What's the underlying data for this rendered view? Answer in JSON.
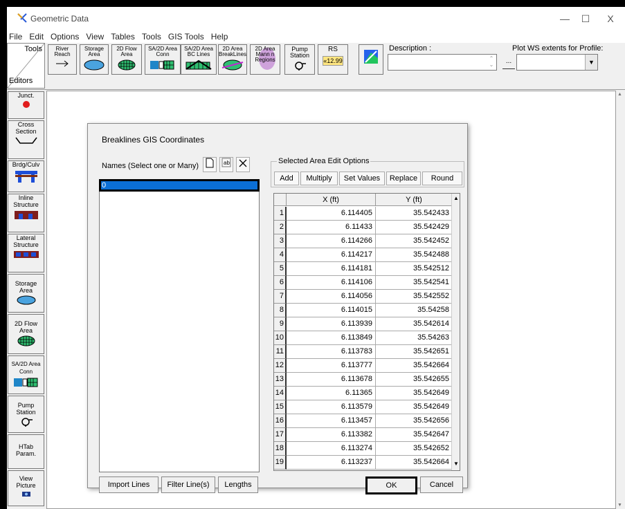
{
  "window": {
    "title": "Geometric Data",
    "controls": {
      "minimize": "—",
      "maximize": "☐",
      "close": "X"
    }
  },
  "menu": [
    "File",
    "Edit",
    "Options",
    "View",
    "Tables",
    "Tools",
    "GIS Tools",
    "Help"
  ],
  "toolbar": {
    "tools_label": "Tools",
    "editors_label": "Editors",
    "buttons": [
      {
        "line1": "River",
        "line2": "Reach"
      },
      {
        "line1": "Storage",
        "line2": "Area"
      },
      {
        "line1": "2D Flow",
        "line2": "Area"
      },
      {
        "line1": "SA/2D Area",
        "line2": "Conn"
      },
      {
        "line1": "SA/2D Area",
        "line2": "BC Lines"
      },
      {
        "line1": "2D Area",
        "line2": "BreakLines"
      },
      {
        "line1": "2D Area",
        "line2": "Mann n",
        "line3": "Regions"
      },
      {
        "line1": "Pump",
        "line2": "Station"
      },
      {
        "line1": "RS",
        "line2": "12.99"
      }
    ],
    "description_label": "Description :",
    "ellipsis": "...",
    "plot_ws_label": "Plot WS extents for Profile:"
  },
  "sidebar": [
    {
      "line1": "Junct.",
      "line2": ""
    },
    {
      "line1": "Cross",
      "line2": "Section"
    },
    {
      "line1": "Brdg/Culv",
      "line2": ""
    },
    {
      "line1": "Inline",
      "line2": "Structure"
    },
    {
      "line1": "Lateral",
      "line2": "Structure"
    },
    {
      "line1": "Storage",
      "line2": "Area"
    },
    {
      "line1": "2D Flow",
      "line2": "Area"
    },
    {
      "line1": "SA/2D Area",
      "line2": "Conn"
    },
    {
      "line1": "Pump",
      "line2": "Station"
    },
    {
      "line1": "HTab",
      "line2": "Param."
    },
    {
      "line1": "View",
      "line2": "Picture"
    }
  ],
  "dialog": {
    "title": "Breaklines GIS Coordinates",
    "names_label": "Names (Select one or Many)",
    "names": [
      "0"
    ],
    "edit_group_title": "Selected Area Edit Options",
    "edit_buttons": [
      "Add",
      "Multiply",
      "Set Values",
      "Replace",
      "Round"
    ],
    "columns": [
      "X (ft)",
      "Y (ft)"
    ],
    "rows": [
      {
        "n": "1",
        "x": "6.114405",
        "y": "35.542433"
      },
      {
        "n": "2",
        "x": "6.11433",
        "y": "35.542429"
      },
      {
        "n": "3",
        "x": "6.114266",
        "y": "35.542452"
      },
      {
        "n": "4",
        "x": "6.114217",
        "y": "35.542488"
      },
      {
        "n": "5",
        "x": "6.114181",
        "y": "35.542512"
      },
      {
        "n": "6",
        "x": "6.114106",
        "y": "35.542541"
      },
      {
        "n": "7",
        "x": "6.114056",
        "y": "35.542552"
      },
      {
        "n": "8",
        "x": "6.114015",
        "y": "35.54258"
      },
      {
        "n": "9",
        "x": "6.113939",
        "y": "35.542614"
      },
      {
        "n": "10",
        "x": "6.113849",
        "y": "35.54263"
      },
      {
        "n": "11",
        "x": "6.113783",
        "y": "35.542651"
      },
      {
        "n": "12",
        "x": "6.113777",
        "y": "35.542664"
      },
      {
        "n": "13",
        "x": "6.113678",
        "y": "35.542655"
      },
      {
        "n": "14",
        "x": "6.11365",
        "y": "35.542649"
      },
      {
        "n": "15",
        "x": "6.113579",
        "y": "35.542649"
      },
      {
        "n": "16",
        "x": "6.113457",
        "y": "35.542656"
      },
      {
        "n": "17",
        "x": "6.113382",
        "y": "35.542647"
      },
      {
        "n": "18",
        "x": "6.113274",
        "y": "35.542652"
      },
      {
        "n": "19",
        "x": "6.113237",
        "y": "35.542664"
      }
    ],
    "bottom_buttons": {
      "import": "Import Lines",
      "filter": "Filter Line(s)",
      "lengths": "Lengths",
      "ok": "OK",
      "cancel": "Cancel"
    }
  },
  "colors": {
    "selection": "#0b6fd6",
    "highlight_border": "#000000"
  }
}
